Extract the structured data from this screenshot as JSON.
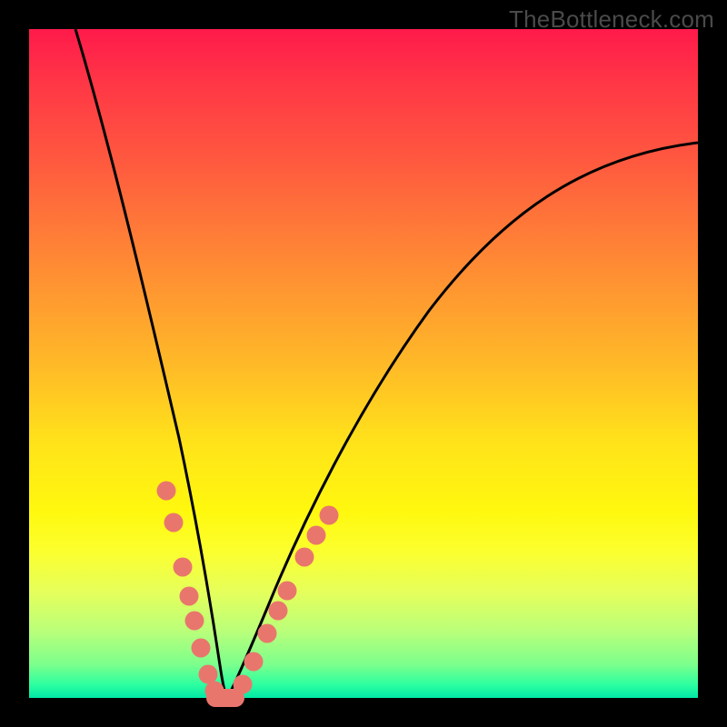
{
  "watermark": "TheBottleneck.com",
  "colors": {
    "background": "#000000",
    "gradient_top": "#ff1a4b",
    "gradient_mid": "#ffe31a",
    "gradient_bottom": "#00e8a6",
    "curve": "#000000",
    "dot": "#e9766d"
  },
  "chart_data": {
    "type": "line",
    "title": "",
    "xlabel": "",
    "ylabel": "",
    "xlim": [
      0,
      100
    ],
    "ylim": [
      0,
      100
    ],
    "series": [
      {
        "name": "left-curve",
        "x": [
          7,
          10,
          13,
          16,
          19,
          22,
          24,
          26,
          27,
          28,
          29
        ],
        "values": [
          100,
          84,
          68,
          52,
          37,
          23,
          13,
          6,
          3,
          1,
          0
        ]
      },
      {
        "name": "right-curve",
        "x": [
          29,
          31,
          34,
          38,
          43,
          50,
          58,
          67,
          76,
          86,
          96,
          100
        ],
        "values": [
          0,
          1,
          5,
          12,
          22,
          34,
          46,
          57,
          66,
          74,
          80,
          83
        ]
      }
    ],
    "markers": {
      "name": "highlighted-points",
      "points": [
        {
          "x": 20.5,
          "y": 31.0
        },
        {
          "x": 21.6,
          "y": 26.2
        },
        {
          "x": 23.0,
          "y": 19.5
        },
        {
          "x": 23.9,
          "y": 15.2
        },
        {
          "x": 24.7,
          "y": 11.5
        },
        {
          "x": 25.7,
          "y": 7.5
        },
        {
          "x": 26.8,
          "y": 3.5
        },
        {
          "x": 27.7,
          "y": 1.1
        },
        {
          "x": 28.5,
          "y": 0.0,
          "wide": true
        },
        {
          "x": 30.2,
          "y": 0.0,
          "wide": true
        },
        {
          "x": 31.9,
          "y": 2.0
        },
        {
          "x": 33.6,
          "y": 5.5
        },
        {
          "x": 35.6,
          "y": 9.7
        },
        {
          "x": 37.2,
          "y": 13.0
        },
        {
          "x": 38.6,
          "y": 16.0
        },
        {
          "x": 41.2,
          "y": 21.0
        },
        {
          "x": 43.0,
          "y": 24.3
        },
        {
          "x": 44.9,
          "y": 27.3
        }
      ]
    }
  }
}
